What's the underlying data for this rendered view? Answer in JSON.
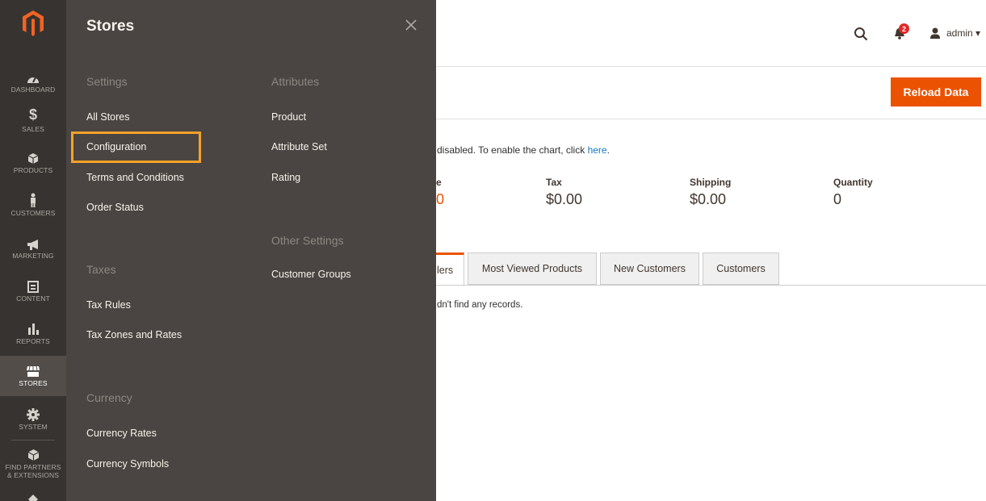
{
  "nav": {
    "items": [
      {
        "label": "DASHBOARD"
      },
      {
        "label": "SALES"
      },
      {
        "label": "PRODUCTS"
      },
      {
        "label": "CUSTOMERS"
      },
      {
        "label": "MARKETING"
      },
      {
        "label": "CONTENT"
      },
      {
        "label": "REPORTS"
      },
      {
        "label": "STORES"
      },
      {
        "label": "SYSTEM"
      },
      {
        "label_line1": "FIND PARTNERS",
        "label_line2": "& EXTENSIONS"
      }
    ],
    "sales_symbol": "$"
  },
  "flyout": {
    "title": "Stores",
    "groups": {
      "settings": {
        "title": "Settings",
        "links": [
          "All Stores",
          "Configuration",
          "Terms and Conditions",
          "Order Status"
        ]
      },
      "taxes": {
        "title": "Taxes",
        "links": [
          "Tax Rules",
          "Tax Zones and Rates"
        ]
      },
      "currency": {
        "title": "Currency",
        "links": [
          "Currency Rates",
          "Currency Symbols"
        ]
      },
      "attributes": {
        "title": "Attributes",
        "links": [
          "Product",
          "Attribute Set",
          "Rating"
        ]
      },
      "other": {
        "title": "Other Settings",
        "links": [
          "Customer Groups"
        ]
      }
    }
  },
  "header": {
    "notification_count": "2",
    "user": "admin ▾"
  },
  "toolbar": {
    "reload_label": "Reload Data"
  },
  "notice": {
    "text": "disabled. To enable the chart, click ",
    "link": "here",
    "end": "."
  },
  "stats": [
    {
      "label": "e",
      "value": "0"
    },
    {
      "label": "Tax",
      "value": "$0.00"
    },
    {
      "label": "Shipping",
      "value": "$0.00"
    },
    {
      "label": "Quantity",
      "value": "0"
    }
  ],
  "tabs": [
    "lers",
    "Most Viewed Products",
    "New Customers",
    "Customers"
  ],
  "grid": {
    "empty_text": "dn't find any records."
  },
  "colors": {
    "accent": "#eb5202",
    "highlight": "#f5a22a",
    "nav_bg": "#373330",
    "flyout_bg": "#4a4542"
  }
}
